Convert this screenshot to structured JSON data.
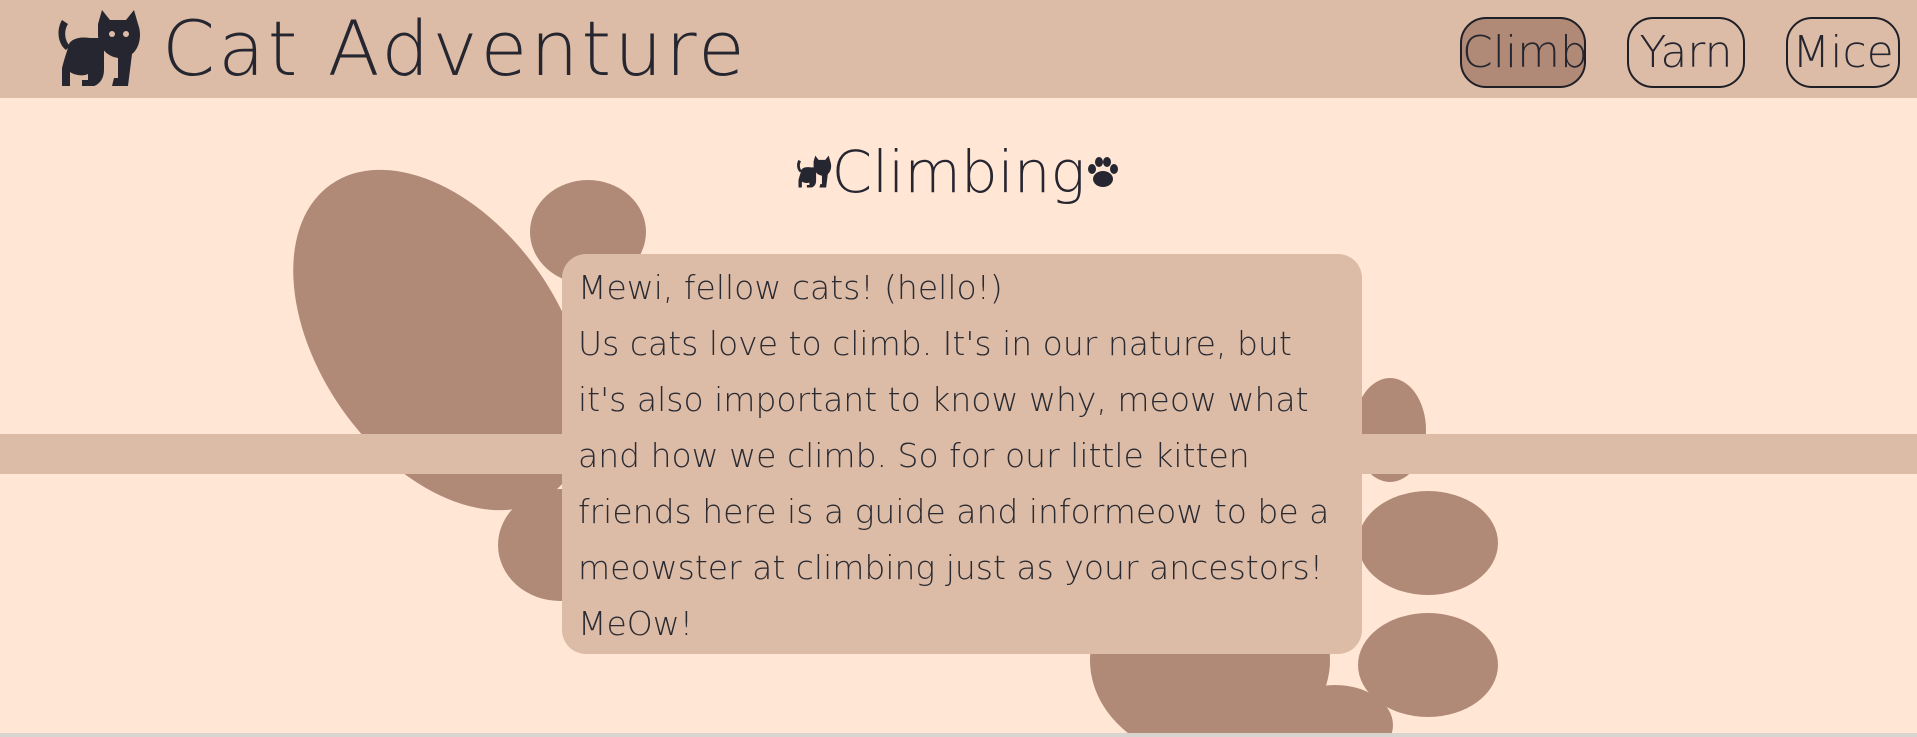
{
  "app": {
    "title": "Cat Adventure",
    "logo_icon": "cat-sitting-icon"
  },
  "nav": {
    "items": [
      {
        "label": "Climb",
        "active": true
      },
      {
        "label": "Yarn",
        "active": false
      },
      {
        "label": "Mice",
        "active": false
      }
    ]
  },
  "section": {
    "title": "Climbing",
    "left_icon": "cat-sitting-icon",
    "right_icon": "paw-icon"
  },
  "card": {
    "greeting": "Mewi, fellow cats! (hello!)",
    "body": "Us cats love to climb. It's in our nature, but it's also important to know why, meow what and how we climb. So for our little kitten friends here is a guide and informeow to be a meowster at climbing just as your ancestors!",
    "signoff": "MeOw!"
  },
  "colors": {
    "background": "#ffe6d5",
    "header": "#dcbca6",
    "paw": "#b08a77",
    "active_button": "#b08a77",
    "text": "#262630"
  }
}
